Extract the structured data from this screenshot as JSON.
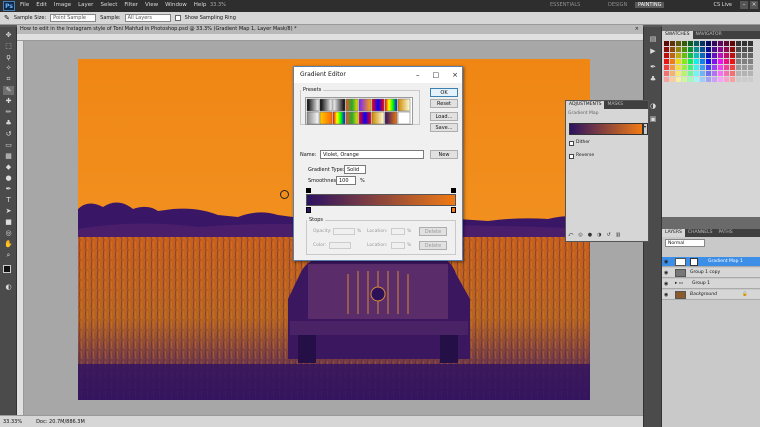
{
  "menubar": {
    "app_icon": "Ps",
    "menus": [
      "File",
      "Edit",
      "Image",
      "Layer",
      "Select",
      "Filter",
      "View",
      "Window",
      "Help"
    ],
    "zoom": "33.3%",
    "workspaces": [
      "ESSENTIALS",
      "DESIGN",
      "PAINTING"
    ],
    "active_workspace": "PAINTING",
    "cs_live": "CS Live"
  },
  "options_bar": {
    "sample_size_label": "Sample Size:",
    "sample_size_value": "Point Sample",
    "sample_label": "Sample:",
    "sample_value": "All Layers",
    "show_ring_label": "Show Sampling Ring"
  },
  "document": {
    "tab_title": "How to edit in the Instagram style of Toni Mahfud in Photoshop.psd @ 33.3% (Gradient Map 1, Layer Mask/8) *"
  },
  "status": {
    "zoom": "33.33%",
    "doc": "Doc: 20.7M/886.3M"
  },
  "gradient_editor": {
    "title": "Gradient Editor",
    "presets_label": "Presets",
    "ok": "OK",
    "reset": "Reset",
    "load": "Load...",
    "save": "Save...",
    "name_label": "Name:",
    "name_value": "Violet, Orange",
    "new": "New",
    "gradient_type_label": "Gradient Type:",
    "gradient_type_value": "Solid",
    "smoothness_label": "Smoothness:",
    "smoothness_value": "100",
    "percent": "%",
    "stops_label": "Stops",
    "opacity_label": "Opacity:",
    "location_label": "Location:",
    "color_label": "Color:",
    "delete": "Delete",
    "gradient_from": "#2b1262",
    "gradient_to": "#f07a14"
  },
  "adjustments": {
    "tabs": [
      "ADJUSTMENTS",
      "MASKS"
    ],
    "panel_title": "Gradient Map",
    "dither": "Dither",
    "reverse": "Reverse"
  },
  "swatches": {
    "tabs": [
      "SWATCHES",
      "NAVIGATOR"
    ]
  },
  "layers": {
    "tabs": [
      "LAYERS",
      "CHANNELS",
      "PATHS"
    ],
    "blend_mode": "Normal",
    "items": [
      {
        "name": "Gradient Map 1"
      },
      {
        "name": "Group 1 copy"
      },
      {
        "name": "Group 1"
      },
      {
        "name": "Background"
      }
    ]
  },
  "colors": {
    "accent_orange": "#ef8a12",
    "deep_violet": "#2f1466",
    "selection_blue": "#3d8ee6"
  }
}
